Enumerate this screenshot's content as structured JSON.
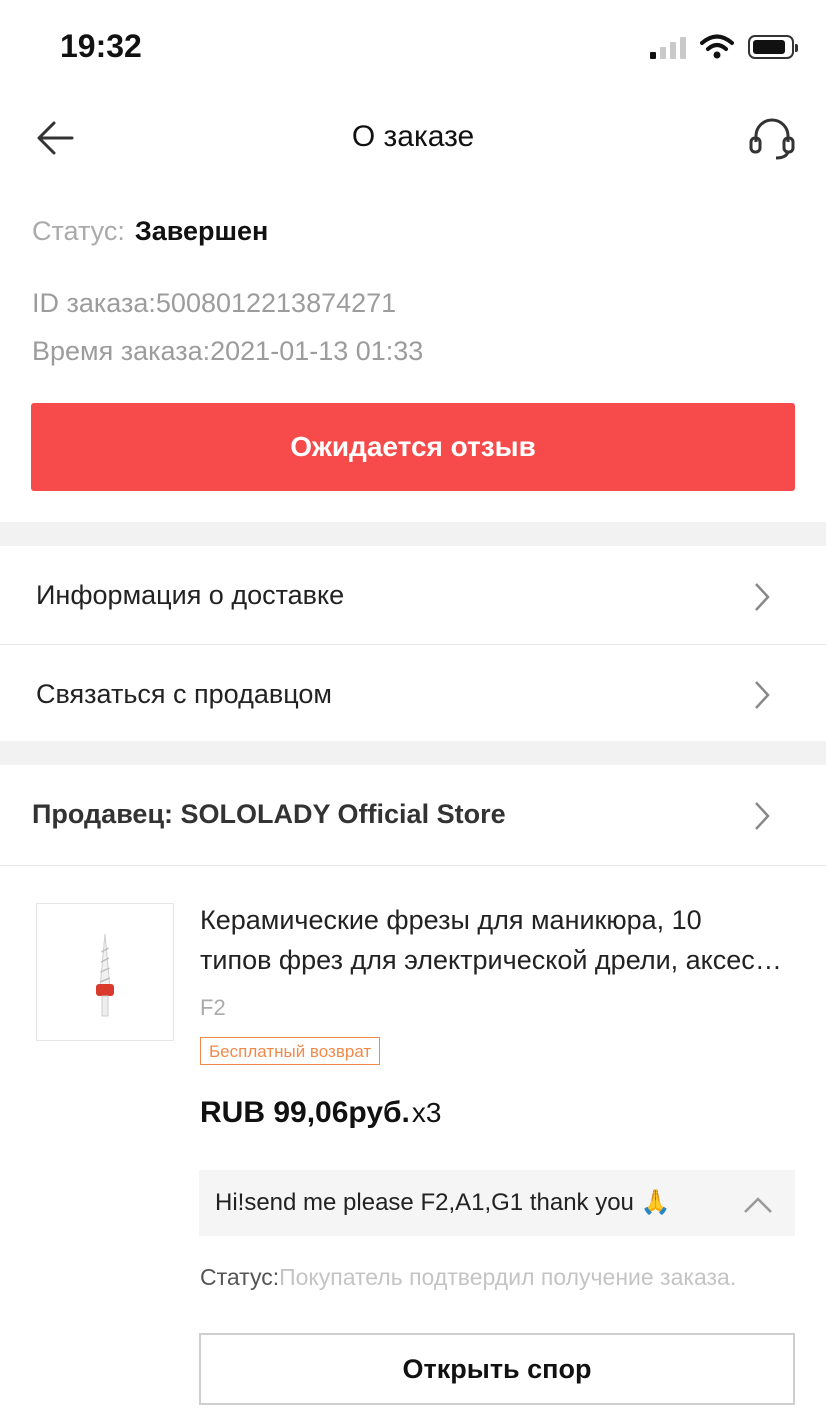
{
  "status_bar": {
    "time": "19:32"
  },
  "header": {
    "title": "О заказе"
  },
  "order": {
    "status_label": "Статус:",
    "status_value": "Завершен",
    "id_text": "ID заказа:5008012213874271",
    "time_text": "Время заказа:2021-01-13 01:33",
    "review_button": "Ожидается отзыв"
  },
  "links": {
    "delivery": "Информация о доставке",
    "contact_seller": "Связаться с продавцом"
  },
  "seller": {
    "label": "Продавец: SOLOLADY Official Store"
  },
  "product": {
    "name_line1": "Керамические фрезы для маникюра, 10",
    "name_line2": "типов фрез для электрической дрели, аксессуары",
    "sku": "F2",
    "badge": "Бесплатный возврат",
    "price": "RUB 99,06руб.",
    "quantity": "x3",
    "buyer_note": "Hi!send me please F2,A1,G1 thank you 🙏",
    "order_status_label": "Статус:",
    "order_status_value": "Покупатель подтвердил получение заказа.",
    "dispute_button": "Открыть спор"
  },
  "icons": {
    "back": "arrow-left-icon",
    "support": "headset-icon",
    "chevron": "chevron-right-icon",
    "collapse": "chevron-up-icon"
  },
  "colors": {
    "accent": "#f74b4b",
    "badge": "#f08a4b",
    "separator": "#f2f2f2"
  }
}
